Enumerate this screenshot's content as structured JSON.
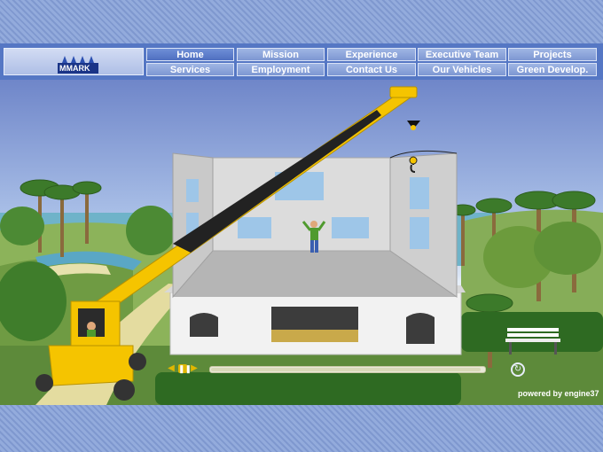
{
  "brand": {
    "logo_text": "MMARK"
  },
  "nav": {
    "row1": [
      "Home",
      "Mission",
      "Experience",
      "Executive Team",
      "Projects"
    ],
    "row2": [
      "Services",
      "Employment",
      "Contact Us",
      "Our Vehicles",
      "Green Develop."
    ],
    "active": "Home"
  },
  "player": {
    "progress": 0.98
  },
  "footer": {
    "powered_by": "powered by engine37"
  },
  "icons": {
    "play_back": "triangle-left-icon",
    "pause": "pause-icon",
    "play_forward": "triangle-right-icon",
    "replay": "replay-icon"
  },
  "colors": {
    "nav_bg": "#5577c4",
    "button": "#8ea6dd",
    "crane": "#f5c400",
    "sky": "#7089cc"
  }
}
